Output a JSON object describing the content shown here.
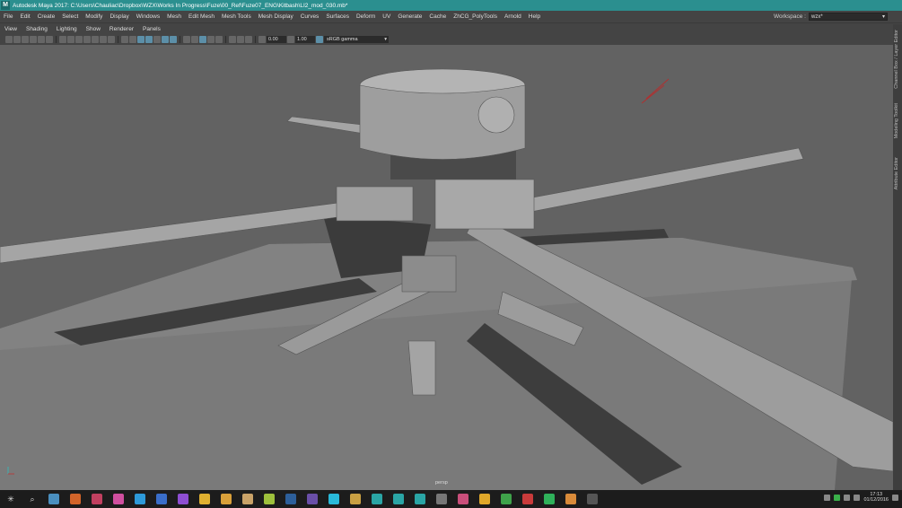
{
  "window": {
    "title": "Autodesk Maya 2017: C:\\Users\\Chauliac\\Dropbox\\WZX\\Works In Progress\\Fuze\\00_Ref\\Fuze07_ENG\\Kitbash\\LI2_mod_030.mb*",
    "logo": "M"
  },
  "menu": [
    "File",
    "Edit",
    "Create",
    "Select",
    "Modify",
    "Display",
    "Windows",
    "Mesh",
    "Edit Mesh",
    "Mesh Tools",
    "Mesh Display",
    "Curves",
    "Surfaces",
    "Deform",
    "UV",
    "Generate",
    "Cache",
    "ZhCG_PolyTools",
    "Arnold",
    "Help"
  ],
  "workspace": {
    "label": "Workspace :",
    "value": "wzx*"
  },
  "panel_menu": [
    "View",
    "Shading",
    "Lighting",
    "Show",
    "Renderer",
    "Panels"
  ],
  "toolbar": {
    "exposure": "0.00",
    "gamma": "1.00",
    "color_space": "sRGB gamma"
  },
  "viewport": {
    "camera": "persp"
  },
  "side_tabs": [
    "Channel Box / Layer Editor",
    "Modeling Toolkit",
    "Attribute Editor"
  ],
  "taskbar": {
    "icons": [
      "start",
      "search",
      "task-view",
      "app-orange",
      "app-red",
      "app-pink",
      "app-cyan",
      "app-blue-ps",
      "app-purple-ae",
      "app-folder",
      "app-chrome",
      "app-file",
      "app-lime",
      "app-ps",
      "app-ae",
      "app-cyan2",
      "app-c4d",
      "app-maya1",
      "app-maya2",
      "app-maya3",
      "app-3",
      "app-pink2",
      "app-yellow",
      "app-green",
      "app-red2",
      "app-spotify",
      "app-substance",
      "app-game"
    ],
    "clock_time": "17:13",
    "clock_date": "01/12/2016"
  },
  "colors": {
    "title_bar": "#2b8f8f",
    "ui_bg": "#444444",
    "viewport_bg": "#626262",
    "accent_blue": "#5c8fa8"
  }
}
